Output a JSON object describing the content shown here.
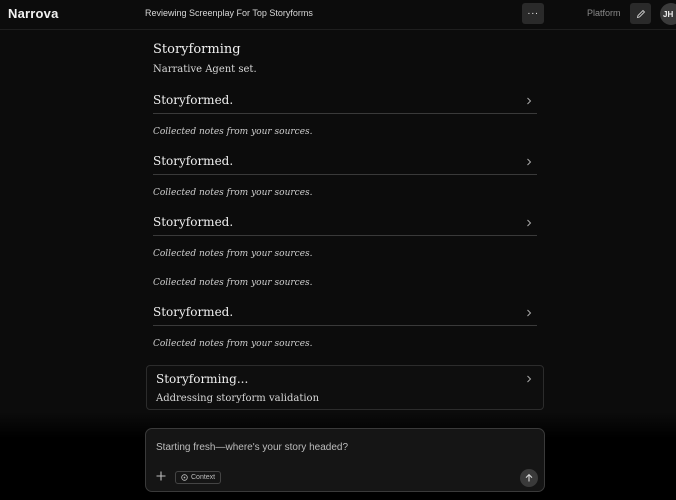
{
  "app": {
    "brand": "Narrova",
    "document_title": "Reviewing Screenplay For Top Storyforms",
    "more_label": "···",
    "platform_label": "Platform",
    "user_initials": "JH"
  },
  "header": {
    "title": "Storyforming",
    "subtitle": "Narrative Agent set."
  },
  "steps": [
    {
      "label": "Storyformed.",
      "note": "Collected notes from your sources."
    },
    {
      "label": "Storyformed.",
      "note": "Collected notes from your sources."
    },
    {
      "label": "Storyformed.",
      "note": "Collected notes from your sources."
    },
    {
      "label": "Storyformed.",
      "note": "Collected notes from your sources."
    }
  ],
  "extra_note": "Collected notes from your sources.",
  "active_step": {
    "title": "Storyforming...",
    "subtitle": "Addressing storyform validation"
  },
  "composer": {
    "placeholder": "Starting fresh—where's your story headed?",
    "context_label": "Context"
  },
  "icons": [
    "more-icon",
    "pencil-icon",
    "chevron-right-icon",
    "plus-icon",
    "context-icon",
    "arrow-up-icon"
  ]
}
